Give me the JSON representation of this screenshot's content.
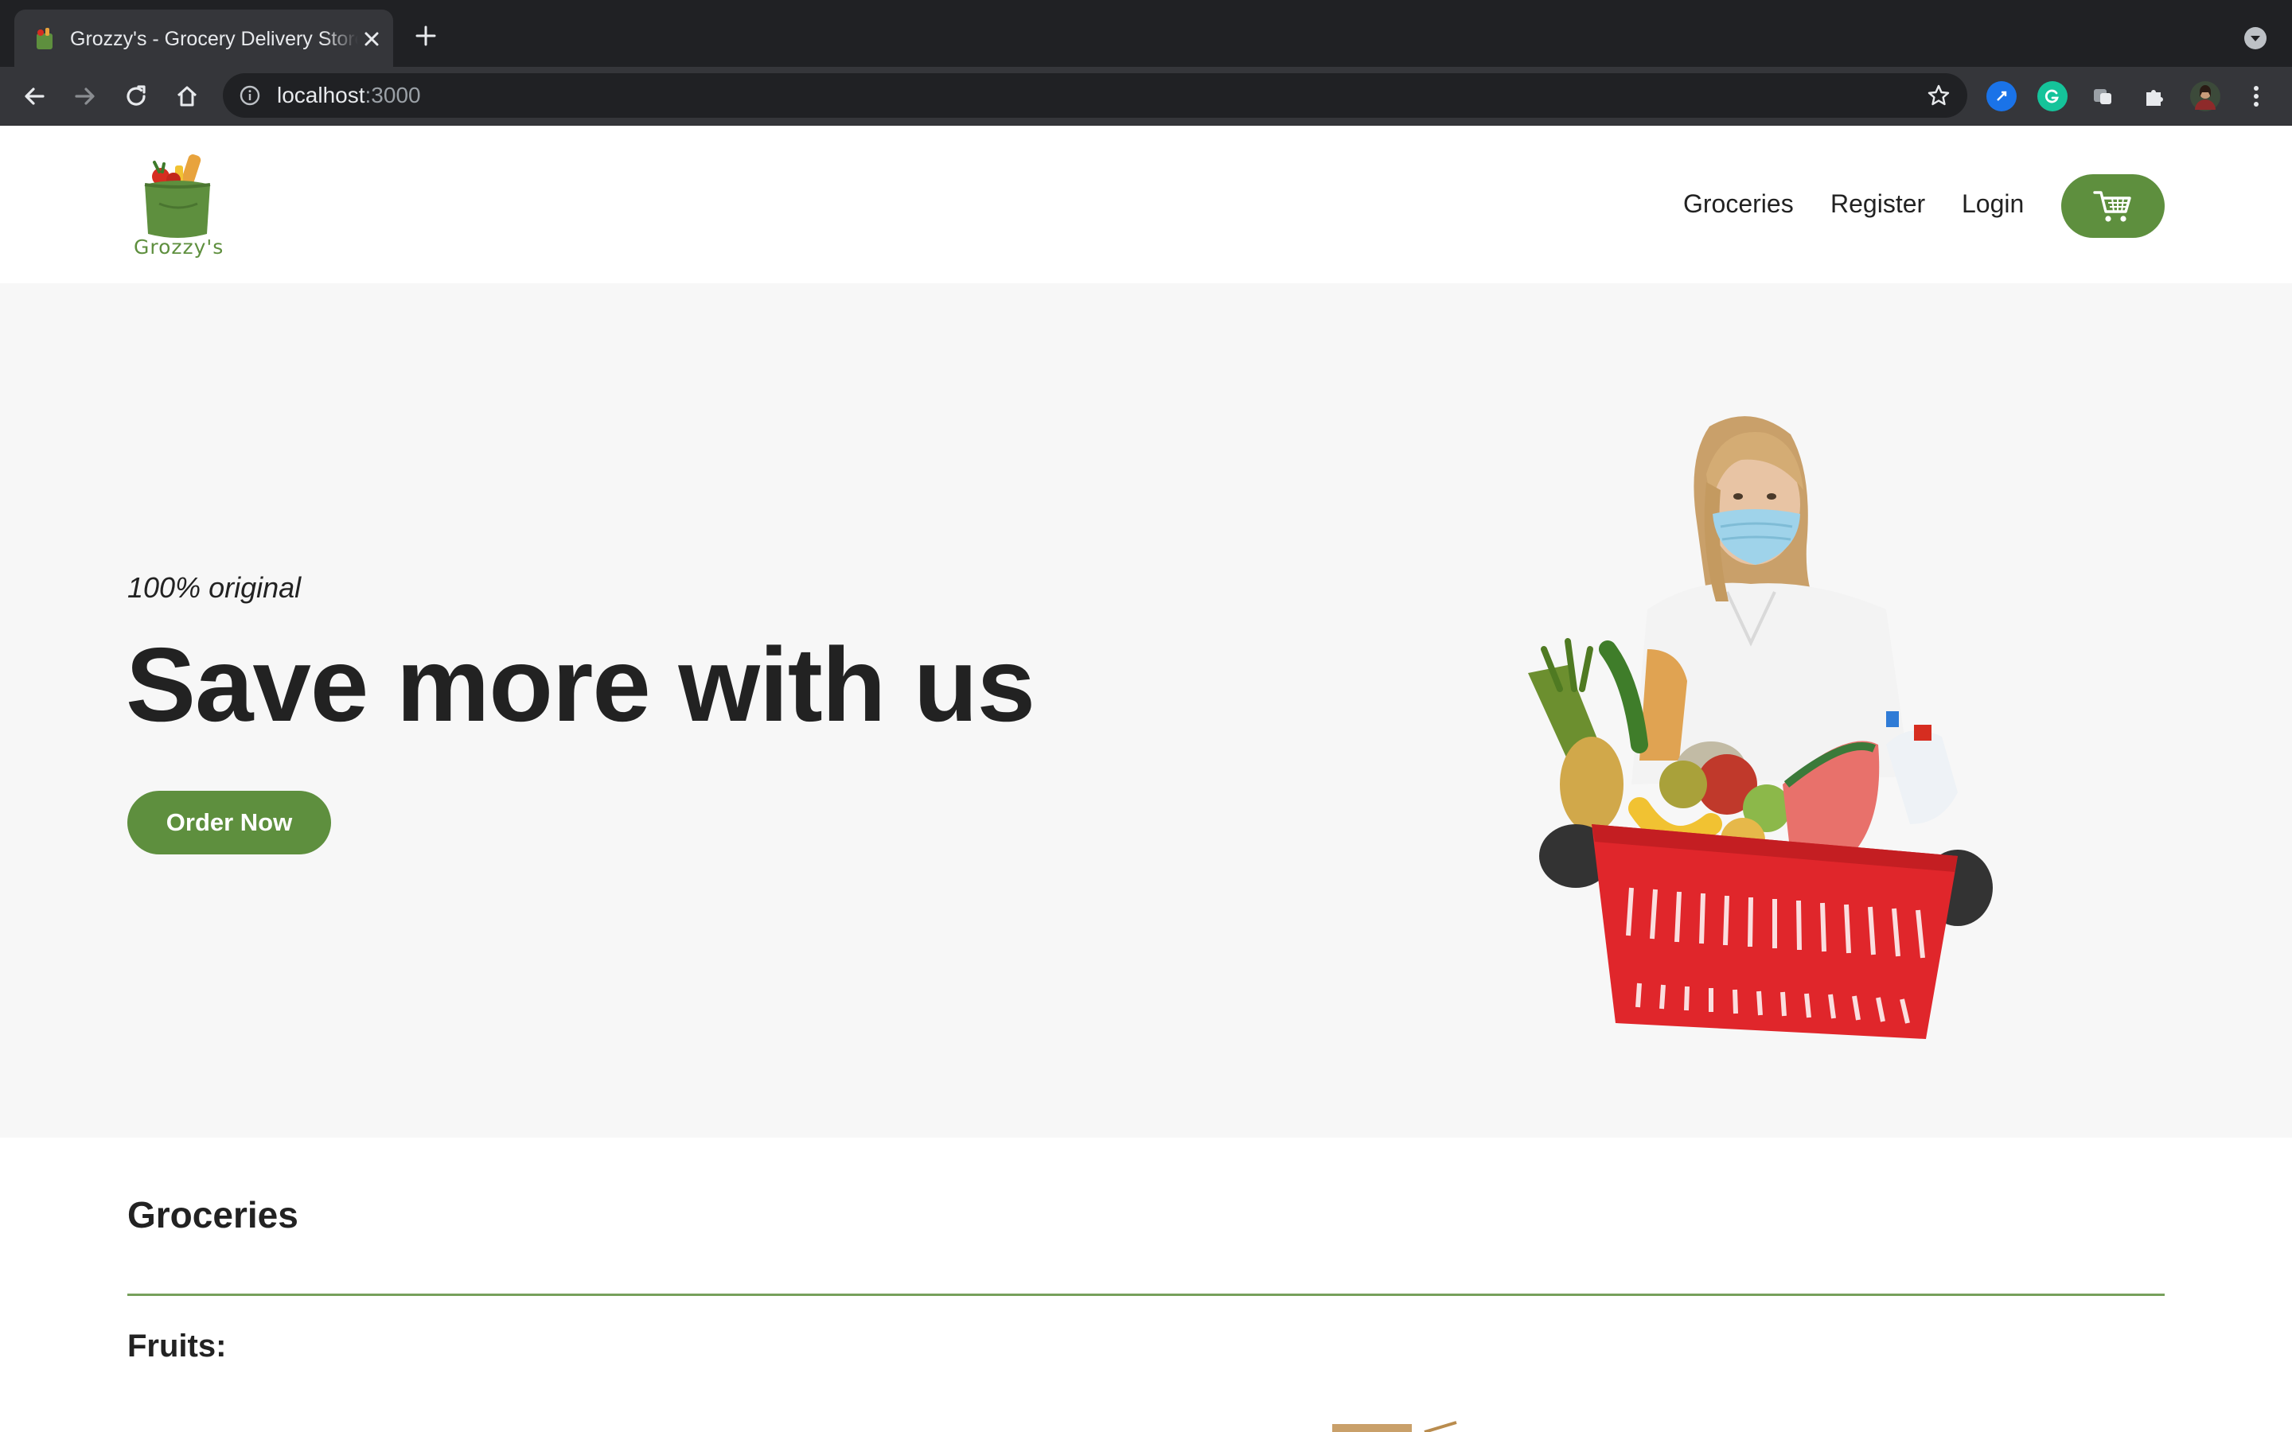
{
  "browser": {
    "tab_title": "Grozzy's - Grocery Delivery Store",
    "url_host": "localhost",
    "url_port": ":3000",
    "colors": {
      "tabstrip": "#202124",
      "toolbar": "#35363a"
    }
  },
  "header": {
    "logo_text": "Grozzy's",
    "nav": {
      "groceries": "Groceries",
      "register": "Register",
      "login": "Login"
    },
    "cart_icon": "shopping-cart-icon"
  },
  "hero": {
    "kicker": "100% original",
    "title": "Save more with us",
    "cta": "Order Now",
    "image": "woman-with-grocery-basket"
  },
  "groceries": {
    "title": "Groceries",
    "category": "Fruits:"
  },
  "theme": {
    "brand_green": "#5e8f3e",
    "hero_bg": "#f7f7f7",
    "text": "#222222"
  }
}
